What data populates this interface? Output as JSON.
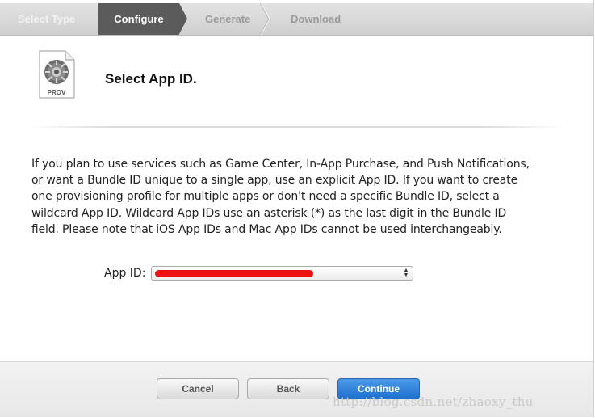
{
  "steps": [
    {
      "label": "Select Type",
      "state": "done"
    },
    {
      "label": "Configure",
      "state": "active"
    },
    {
      "label": "Generate",
      "state": "pending"
    },
    {
      "label": "Download",
      "state": "pending"
    }
  ],
  "header": {
    "icon_label": "PROV",
    "title": "Select App ID."
  },
  "description": "If you plan to use services such as Game Center, In-App Purchase, and Push Notifications, or want a Bundle ID unique to a single app, use an explicit App ID. If you want to create one provisioning profile for multiple apps or don't need a specific Bundle ID, select a wildcard App ID. Wildcard App IDs use an asterisk (*) as the last digit in the Bundle ID field. Please note that iOS App IDs and Mac App IDs cannot be used interchangeably.",
  "app_id": {
    "label": "App ID:",
    "selected_value": ""
  },
  "buttons": {
    "cancel": "Cancel",
    "back": "Back",
    "continue": "Continue"
  },
  "watermark": "http://blog.csdn.net/zhaoxy_thu",
  "colors": {
    "active_step": "#5b5b5b",
    "primary_button": "#1f6fcf",
    "redaction": "#ee1111"
  }
}
